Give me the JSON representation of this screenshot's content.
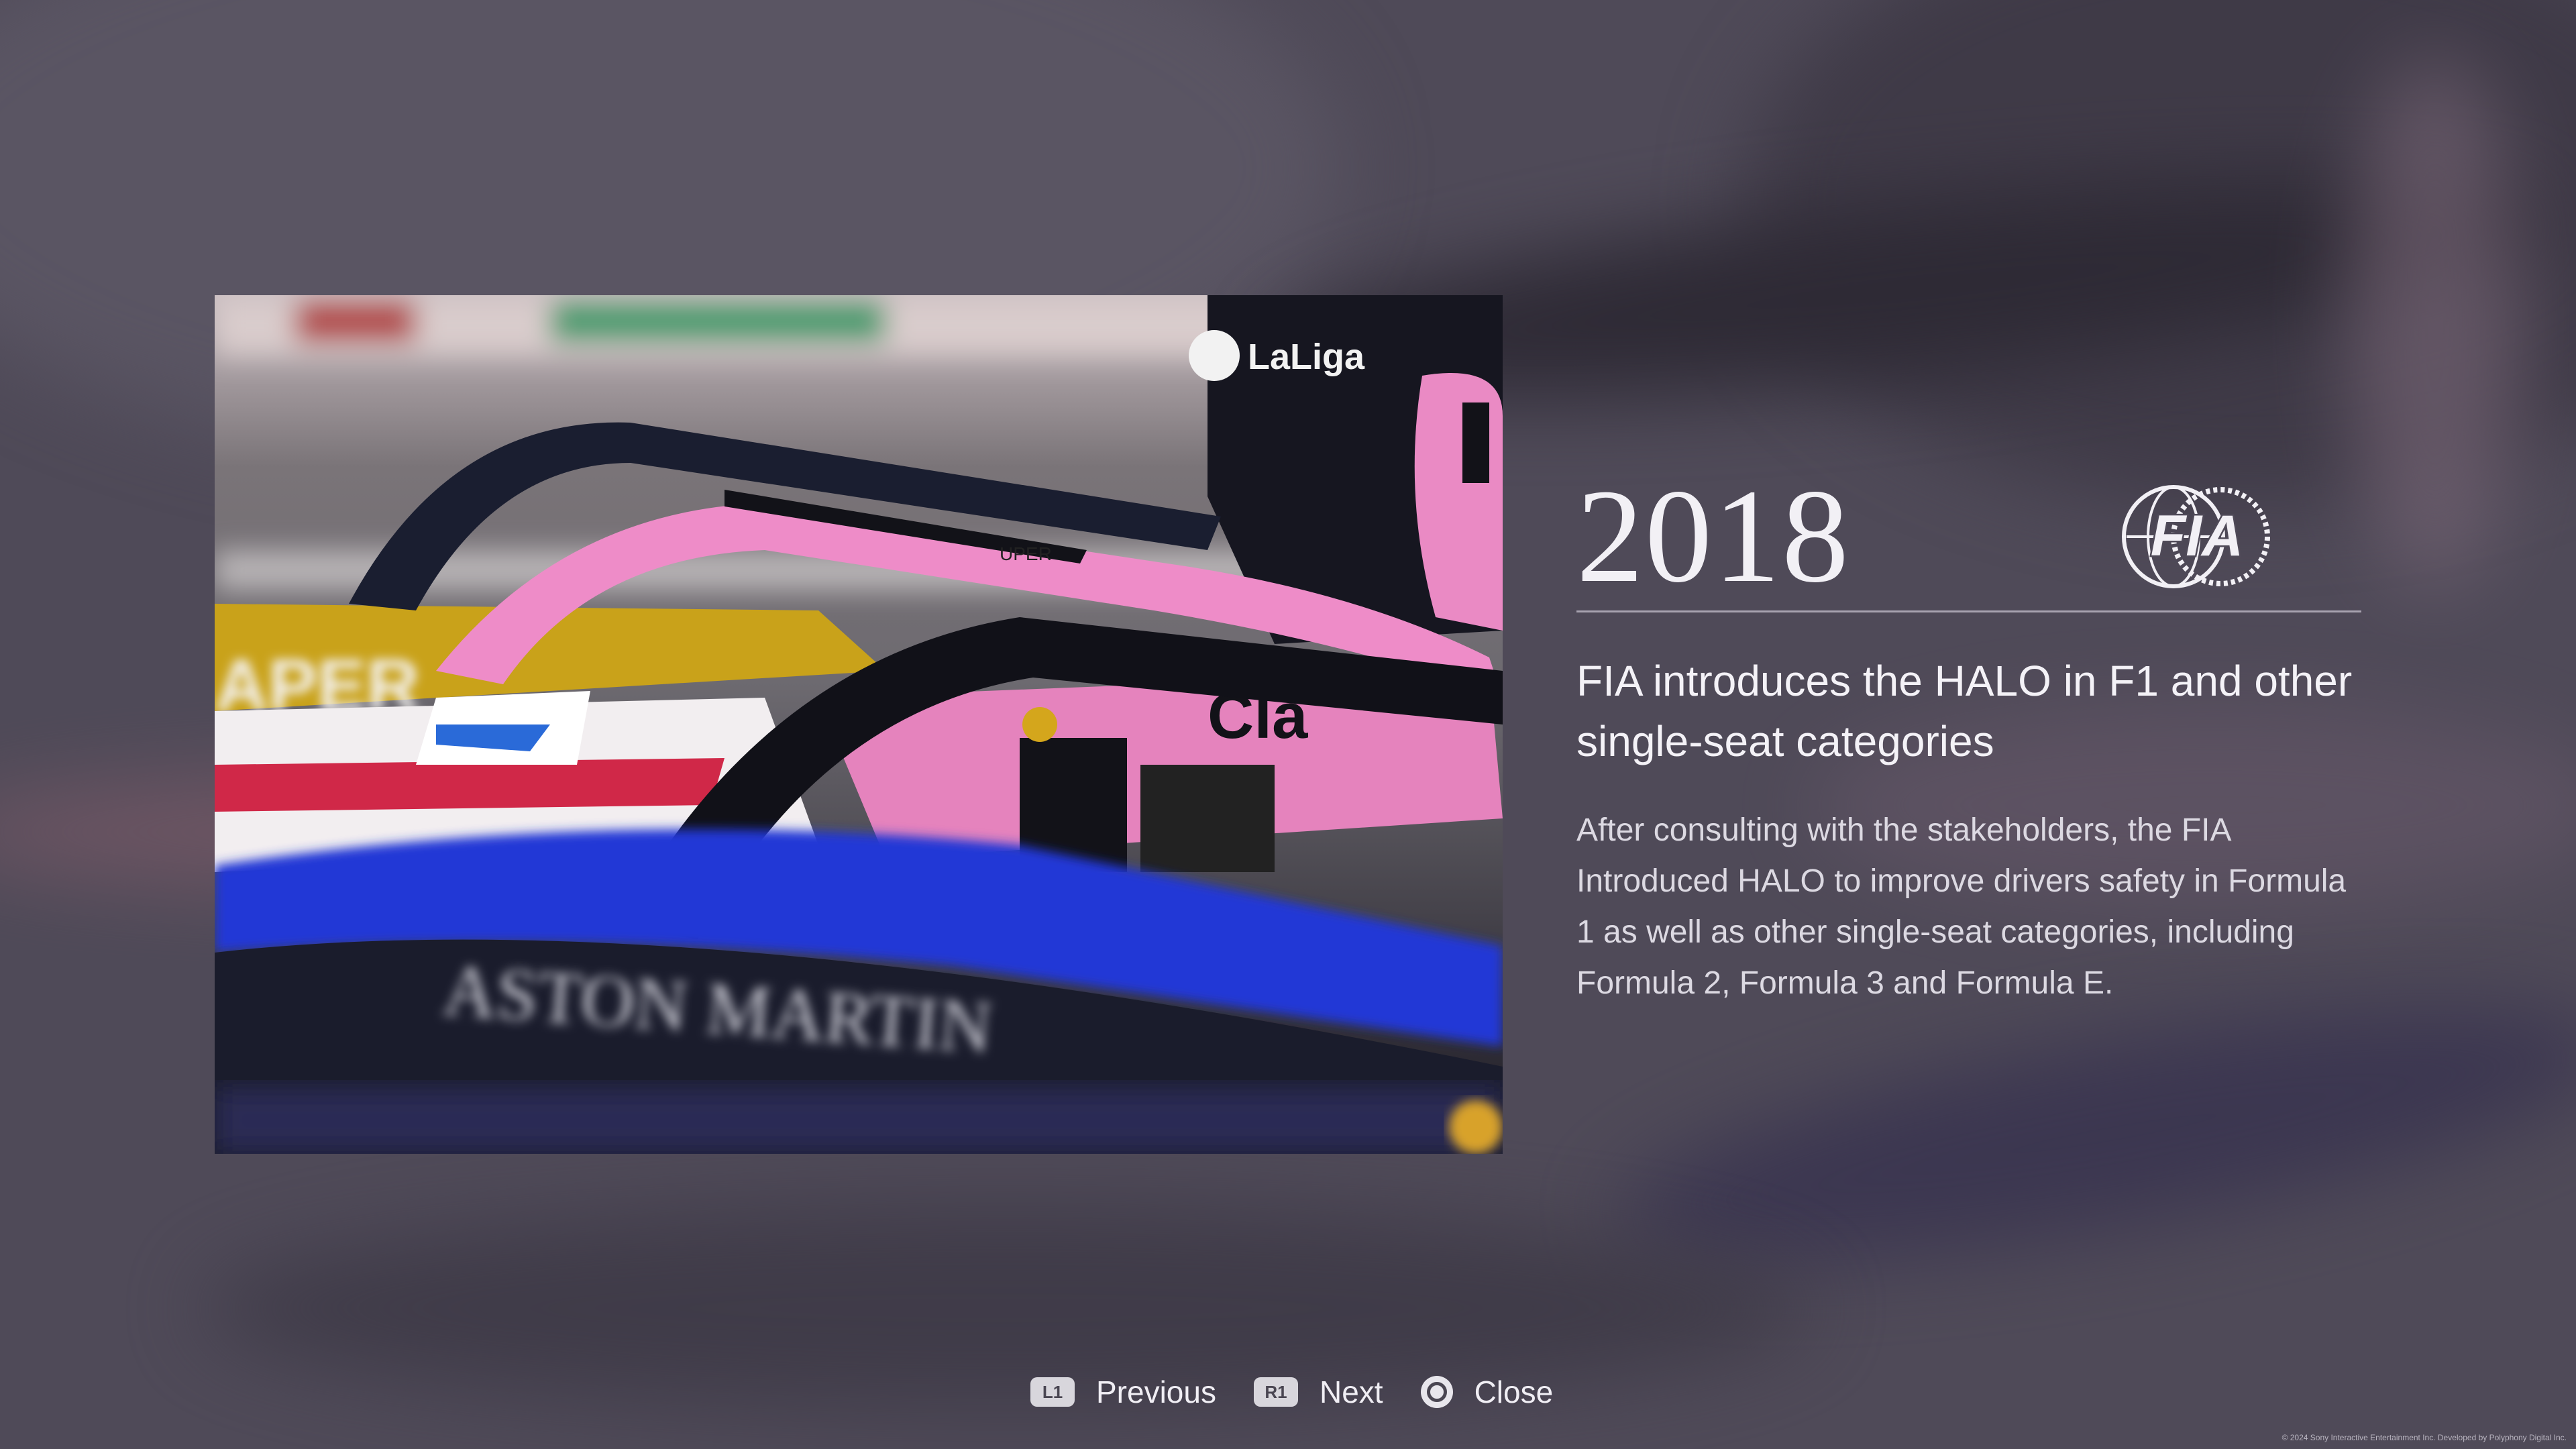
{
  "year": "2018",
  "logo_text": "FIA",
  "headline": "FIA introduces the HALO in F1 and other single-seat categories",
  "description": "After consulting with the stakeholders, the FIA Introduced HALO to improve drivers safety in Formula 1 as well as other single-seat categories, including Formula 2, Formula 3 and Formula E.",
  "controls": {
    "previous": {
      "button": "L1",
      "label": "Previous"
    },
    "next": {
      "button": "R1",
      "label": "Next"
    },
    "close": {
      "button": "circle-button-icon",
      "label": "Close"
    }
  },
  "photo_text": {
    "sponsor_top": "LaLiga",
    "sponsor_side": "ASTON MARTIN",
    "halo_text": "UPER"
  },
  "copyright": "© 2024 Sony Interactive Entertainment Inc. Developed by Polyphony Digital Inc.",
  "colors": {
    "background": "#4f4a58",
    "accent_pink": "#e985c0",
    "halo_blue": "#2a3adf"
  }
}
